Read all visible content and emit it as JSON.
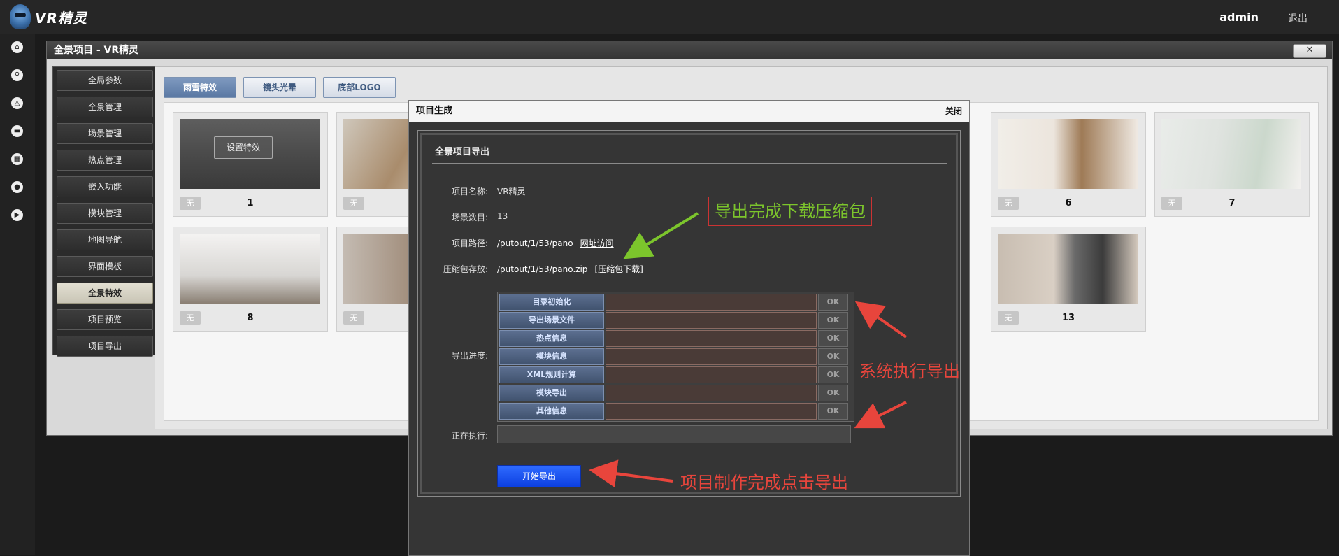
{
  "header": {
    "logo_text": "VR精灵",
    "user": "admin",
    "logout": "退出"
  },
  "rail_icons": [
    "home-icon",
    "walker-icon",
    "compass-icon",
    "folder-icon",
    "grid-icon",
    "user-icon",
    "play-icon"
  ],
  "window": {
    "title": "全景项目 - VR精灵",
    "close_label": "✕"
  },
  "sidebar": {
    "items": [
      {
        "label": "全局参数"
      },
      {
        "label": "全景管理"
      },
      {
        "label": "场景管理"
      },
      {
        "label": "热点管理"
      },
      {
        "label": "嵌入功能"
      },
      {
        "label": "模块管理"
      },
      {
        "label": "地图导航"
      },
      {
        "label": "界面模板"
      },
      {
        "label": "全景特效",
        "active": true
      },
      {
        "label": "项目预览"
      },
      {
        "label": "项目导出"
      }
    ]
  },
  "tabs": [
    {
      "label": "雨雪特效",
      "active": true
    },
    {
      "label": "镜头光晕"
    },
    {
      "label": "底部LOGO"
    }
  ],
  "scenes": [
    {
      "num": "1",
      "badge": "无",
      "action": "设置特效"
    },
    {
      "num": "",
      "badge": "无"
    },
    {
      "num": "6",
      "badge": "无"
    },
    {
      "num": "7",
      "badge": "无"
    },
    {
      "num": "8",
      "badge": "无"
    },
    {
      "num": "",
      "badge": "无"
    },
    {
      "num": "13",
      "badge": "无"
    }
  ],
  "modal": {
    "title": "项目生成",
    "close": "关闭",
    "panel_title": "全景项目导出",
    "name_label": "项目名称:",
    "name_value": "VR精灵",
    "count_label": "场景数目:",
    "count_value": "13",
    "path_label": "项目路径:",
    "path_value": "/putout/1/53/pano",
    "path_link": "网址访问",
    "zip_label": "压缩包存放:",
    "zip_value": "/putout/1/53/pano.zip",
    "zip_link": "[压缩包下载]",
    "progress_label": "导出进度:",
    "steps": [
      {
        "name": "目录初始化",
        "status": "OK"
      },
      {
        "name": "导出场景文件",
        "status": "OK"
      },
      {
        "name": "热点信息",
        "status": "OK"
      },
      {
        "name": "模块信息",
        "status": "OK"
      },
      {
        "name": "XML规则计算",
        "status": "OK"
      },
      {
        "name": "模块导出",
        "status": "OK"
      },
      {
        "name": "其他信息",
        "status": "OK"
      }
    ],
    "running_label": "正在执行:",
    "start_button": "开始导出"
  },
  "annotations": {
    "download": "导出完成下载压缩包",
    "system": "系统执行导出",
    "start": "项目制作完成点击导出"
  },
  "colors": {
    "annotation_red": "#e8453c",
    "annotation_green": "#7cc52c",
    "start_blue": "#1f55ff"
  }
}
